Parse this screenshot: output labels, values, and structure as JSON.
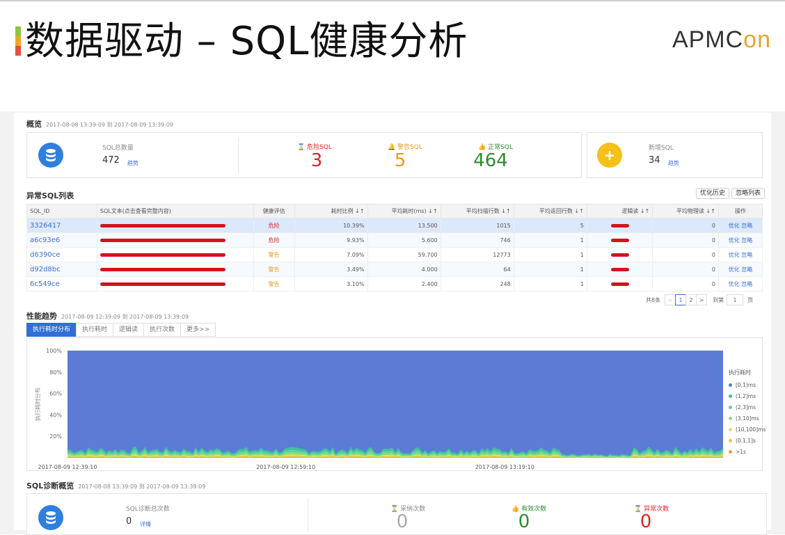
{
  "slide": {
    "title": "数据驱动 – SQL健康分析",
    "logo_main": "APMC",
    "logo_accent": "on",
    "accent_colors": [
      "#8dc63f",
      "#f5a623",
      "#e94e3c"
    ]
  },
  "overview": {
    "title": "概览",
    "range": "2017-08-08 13:39:09 到 2017-08-09 13:39:09",
    "total_label": "SQL总数量",
    "total_value": "472",
    "trend": "趋势",
    "danger_label": "危险SQL",
    "danger_value": "3",
    "warn_label": "警告SQL",
    "warn_value": "5",
    "normal_label": "正常SQL",
    "normal_value": "464",
    "new_label": "新增SQL",
    "new_value": "34",
    "new_trend": "趋势",
    "colors": {
      "danger": "#e02424",
      "warn": "#e69a19",
      "normal": "#2e8b2e",
      "blue": "#2f7fde",
      "yellow": "#f5c01a"
    }
  },
  "abnormal": {
    "title": "异常SQL列表",
    "btn_history": "优化历史",
    "btn_ignore": "忽略列表",
    "headers": [
      "SQL_ID",
      "SQL文本(点击查看完整内容)",
      "健康评估",
      "耗时比例 ↓↑",
      "平均耗时(ms) ↓↑",
      "平均扫描行数 ↓↑",
      "平均返回行数 ↓↑",
      "逻辑读 ↓↑",
      "平均物理读 ↓↑",
      "操作"
    ],
    "rows": [
      {
        "id": "3326417",
        "health": "危险",
        "ratio": "10.39%",
        "avg": "13.500",
        "scan": "1015",
        "ret": "5",
        "phys": "0",
        "op1": "优化",
        "op2": "忽略"
      },
      {
        "id": "a6c93e6",
        "health": "危险",
        "ratio": "9.93%",
        "avg": "5.600",
        "scan": "746",
        "ret": "1",
        "phys": "0",
        "op1": "优化",
        "op2": "忽略"
      },
      {
        "id": "d6390ce",
        "health": "警告",
        "ratio": "7.09%",
        "avg": "59.700",
        "scan": "12773",
        "ret": "1",
        "phys": "0",
        "op1": "优化",
        "op2": "忽略"
      },
      {
        "id": "d92d8bc",
        "health": "警告",
        "ratio": "3.49%",
        "avg": "4.000",
        "scan": "64",
        "ret": "1",
        "phys": "0",
        "op1": "优化",
        "op2": "忽略"
      },
      {
        "id": "6c549ce",
        "health": "警告",
        "ratio": "3.10%",
        "avg": "2.400",
        "scan": "248",
        "ret": "1",
        "phys": "0",
        "op1": "优化",
        "op2": "忽略"
      }
    ],
    "pager": {
      "total": "共8条",
      "p1": "1",
      "p2": "2",
      "goto": "到第",
      "page": "1",
      "unit": "页",
      "prev": "<",
      "next": ">"
    }
  },
  "trend": {
    "title": "性能趋势",
    "range": "2017-08-09 12:39:09 到 2017-08-09 13:39:09",
    "tabs": [
      "执行耗时分布",
      "执行耗时",
      "逻辑读",
      "执行次数",
      "更多>>"
    ],
    "ylabel": "执行耗时分布",
    "legend_title": "执行耗时"
  },
  "chart_data": {
    "type": "area",
    "x": [
      "2017-08-09 12:39:10",
      "2017-08-09 12:59:10",
      "2017-08-09 13:19:10"
    ],
    "yticks": [
      "20%",
      "40%",
      "60%",
      "80%",
      "100%"
    ],
    "ylim": [
      0,
      100
    ],
    "ylabel": "执行耗时分布",
    "legend_title": "执行耗时",
    "legend_position": "right",
    "series": [
      {
        "name": "[0,1)ms",
        "color": "#5b7bd5",
        "approx_share": 95
      },
      {
        "name": "(1,2]ms",
        "color": "#3ec1a0",
        "approx_share": 1
      },
      {
        "name": "(2,3]ms",
        "color": "#5fd49a",
        "approx_share": 1
      },
      {
        "name": "(3,10]ms",
        "color": "#8fe07a",
        "approx_share": 1
      },
      {
        "name": "(10,100]ms",
        "color": "#d6ea5a",
        "approx_share": 1
      },
      {
        "name": "(0.1,1]s",
        "color": "#f2c43f",
        "approx_share": 0.5
      },
      {
        "name": ">1s",
        "color": "#f29a3a",
        "approx_share": 0.5
      }
    ]
  },
  "diag": {
    "title": "SQL诊断概览",
    "range": "2017-08-08 13:39:09 到 2017-08-09 13:39:09",
    "total_label": "SQL诊断总次数",
    "total_value": "0",
    "detail": "详情",
    "adopt_label": "采纳次数",
    "adopt_value": "0",
    "valid_label": "有效次数",
    "valid_value": "0",
    "abn_label": "异常次数",
    "abn_value": "0"
  }
}
